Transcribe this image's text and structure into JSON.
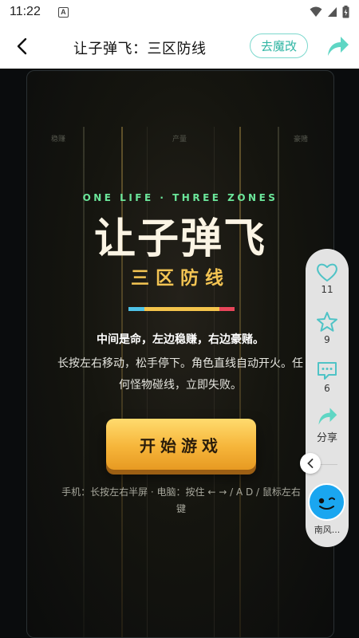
{
  "status_bar": {
    "time": "11:22",
    "notification_letter": "A"
  },
  "header": {
    "title": "让子弹飞：三区防线",
    "mod_button": "去魔改"
  },
  "game": {
    "hud_left": "稳赚",
    "hud_center": "产量",
    "hud_right": "豪赌",
    "subtitle_en": "ONE LIFE · THREE ZONES",
    "title": "让子弹飞",
    "subtitle": "三区防线",
    "tagline": "中间是命，左边稳赚，右边豪赌。",
    "description": "长按左右移动，松手停下。角色直线自动开火。任何怪物碰线，立即失败。",
    "start_button": "开始游戏",
    "hint": "手机：长按左右半屏 · 电脑：按住 ← → / A D / 鼠标左右键",
    "colors": {
      "accent_green": "#6be69a",
      "accent_gold": "#f3c453",
      "zone_left": "#4fc3e8",
      "zone_mid": "#f4c44c",
      "zone_right": "#e8465a"
    }
  },
  "side_panel": {
    "like_count": "11",
    "star_count": "9",
    "comment_count": "6",
    "share_label": "分享",
    "author_name": "南风..."
  }
}
